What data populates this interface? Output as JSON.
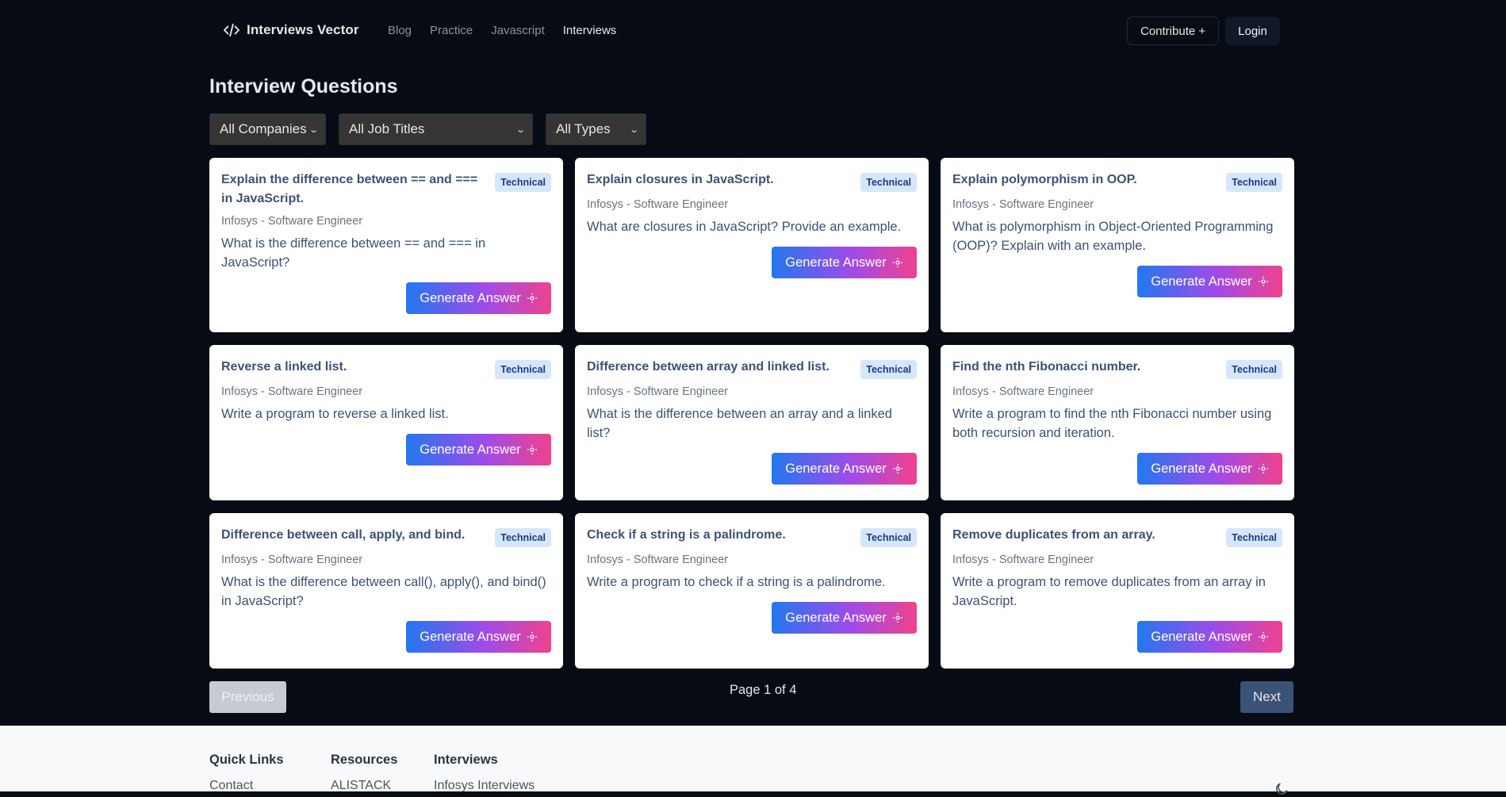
{
  "header": {
    "brand": "Interviews Vector",
    "nav": [
      {
        "label": "Blog",
        "active": false
      },
      {
        "label": "Practice",
        "active": false
      },
      {
        "label": "Javascript",
        "active": false
      },
      {
        "label": "Interviews",
        "active": true
      }
    ],
    "contribute_label": "Contribute +",
    "login_label": "Login"
  },
  "page": {
    "title": "Interview Questions"
  },
  "filters": {
    "company": "All Companies",
    "job_title": "All Job Titles",
    "type": "All Types"
  },
  "cards": [
    {
      "title": "Explain the difference between == and === in JavaScript.",
      "badge": "Technical",
      "meta": "Infosys - Software Engineer",
      "body": "What is the difference between == and === in JavaScript?",
      "button": "Generate Answer"
    },
    {
      "title": "Explain closures in JavaScript.",
      "badge": "Technical",
      "meta": "Infosys - Software Engineer",
      "body": "What are closures in JavaScript? Provide an example.",
      "button": "Generate Answer"
    },
    {
      "title": "Explain polymorphism in OOP.",
      "badge": "Technical",
      "meta": "Infosys - Software Engineer",
      "body": "What is polymorphism in Object-Oriented Programming (OOP)? Explain with an example.",
      "button": "Generate Answer"
    },
    {
      "title": "Reverse a linked list.",
      "badge": "Technical",
      "meta": "Infosys - Software Engineer",
      "body": "Write a program to reverse a linked list.",
      "button": "Generate Answer"
    },
    {
      "title": "Difference between array and linked list.",
      "badge": "Technical",
      "meta": "Infosys - Software Engineer",
      "body": "What is the difference between an array and a linked list?",
      "button": "Generate Answer"
    },
    {
      "title": "Find the nth Fibonacci number.",
      "badge": "Technical",
      "meta": "Infosys - Software Engineer",
      "body": "Write a program to find the nth Fibonacci number using both recursion and iteration.",
      "button": "Generate Answer"
    },
    {
      "title": "Difference between call, apply, and bind.",
      "badge": "Technical",
      "meta": "Infosys - Software Engineer",
      "body": "What is the difference between call(), apply(), and bind() in JavaScript?",
      "button": "Generate Answer"
    },
    {
      "title": "Check if a string is a palindrome.",
      "badge": "Technical",
      "meta": "Infosys - Software Engineer",
      "body": "Write a program to check if a string is a palindrome.",
      "button": "Generate Answer"
    },
    {
      "title": "Remove duplicates from an array.",
      "badge": "Technical",
      "meta": "Infosys - Software Engineer",
      "body": "Write a program to remove duplicates from an array in JavaScript.",
      "button": "Generate Answer"
    }
  ],
  "pagination": {
    "previous_label": "Previous",
    "next_label": "Next",
    "indicator": "Page 1 of 4",
    "current_page": 1,
    "total_pages": 4
  },
  "footer": {
    "columns": [
      {
        "heading": "Quick Links",
        "links": [
          "Contact"
        ]
      },
      {
        "heading": "Resources",
        "links": [
          "ALISTACK"
        ]
      },
      {
        "heading": "Interviews",
        "links": [
          "Infosys Interviews"
        ]
      }
    ],
    "theme_toggle_icon": "moon-icon"
  },
  "colors": {
    "page_bg": "#070b13",
    "card_bg": "#ffffff",
    "title_text": "#3b5277",
    "badge_bg": "#d6e6fb",
    "badge_text": "#1e3a8a",
    "gradient_start": "#2377f0",
    "gradient_mid": "#a04be8",
    "gradient_end": "#f0428d",
    "next_button": "#3b5277",
    "footer_bg": "#f8f9fb"
  }
}
